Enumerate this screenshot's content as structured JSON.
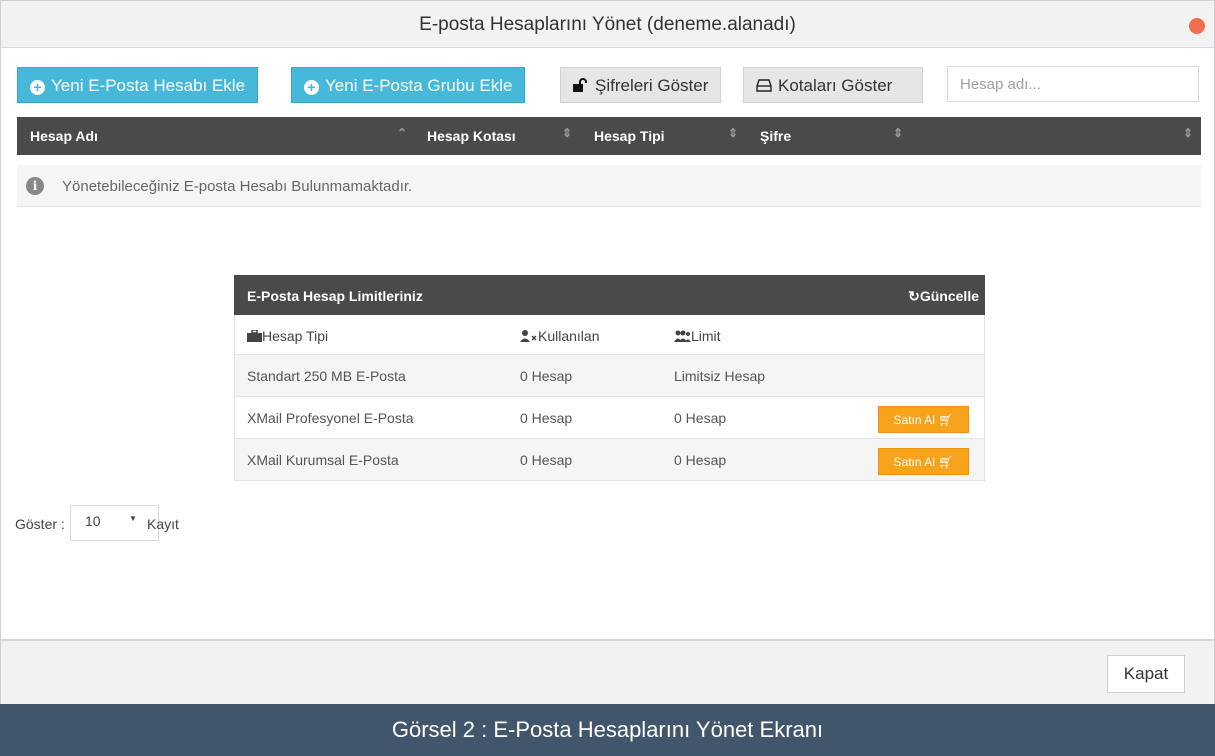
{
  "window": {
    "title": "E-posta Hesaplarını Yönet (deneme.alanadı)"
  },
  "toolbar": {
    "add_account": "Yeni E-Posta Hesabı Ekle",
    "add_group": "Yeni E-Posta Grubu Ekle",
    "show_passwords": "Şifreleri Göster",
    "show_quotas": "Kotaları Göster",
    "search_placeholder": "Hesap adı..."
  },
  "table": {
    "headers": [
      "Hesap Adı",
      "Hesap Kotası",
      "Hesap Tipi",
      "Şifre"
    ],
    "empty_message": "Yönetebileceğiniz E-posta Hesabı Bulunmamaktadır."
  },
  "limits": {
    "title": "E-Posta Hesap Limitleriniz",
    "refresh_label": "Güncelle",
    "columns": [
      "Hesap Tipi",
      "Kullanılan",
      "Limit"
    ],
    "rows": [
      {
        "type": "Standart 250 MB E-Posta",
        "used": "0 Hesap",
        "limit": "Limitsiz Hesap",
        "buy": ""
      },
      {
        "type": "XMail Profesyonel E-Posta",
        "used": "0 Hesap",
        "limit": "0 Hesap",
        "buy": "Satın Al"
      },
      {
        "type": "XMail Kurumsal E-Posta",
        "used": "0 Hesap",
        "limit": "0 Hesap",
        "buy": "Satın Al"
      }
    ]
  },
  "pager": {
    "label": "Göster :",
    "value": "10",
    "suffix": "Kayıt"
  },
  "footer": {
    "close_label": "Kapat"
  },
  "caption": "Görsel 2 : E-Posta Hesaplarını Yönet Ekranı",
  "colors": {
    "accent": "#46b8da",
    "header": "#4a4a4a",
    "buy": "#f7a31b",
    "caption_bg": "#41566b",
    "close_dot": "#f26c4f"
  }
}
